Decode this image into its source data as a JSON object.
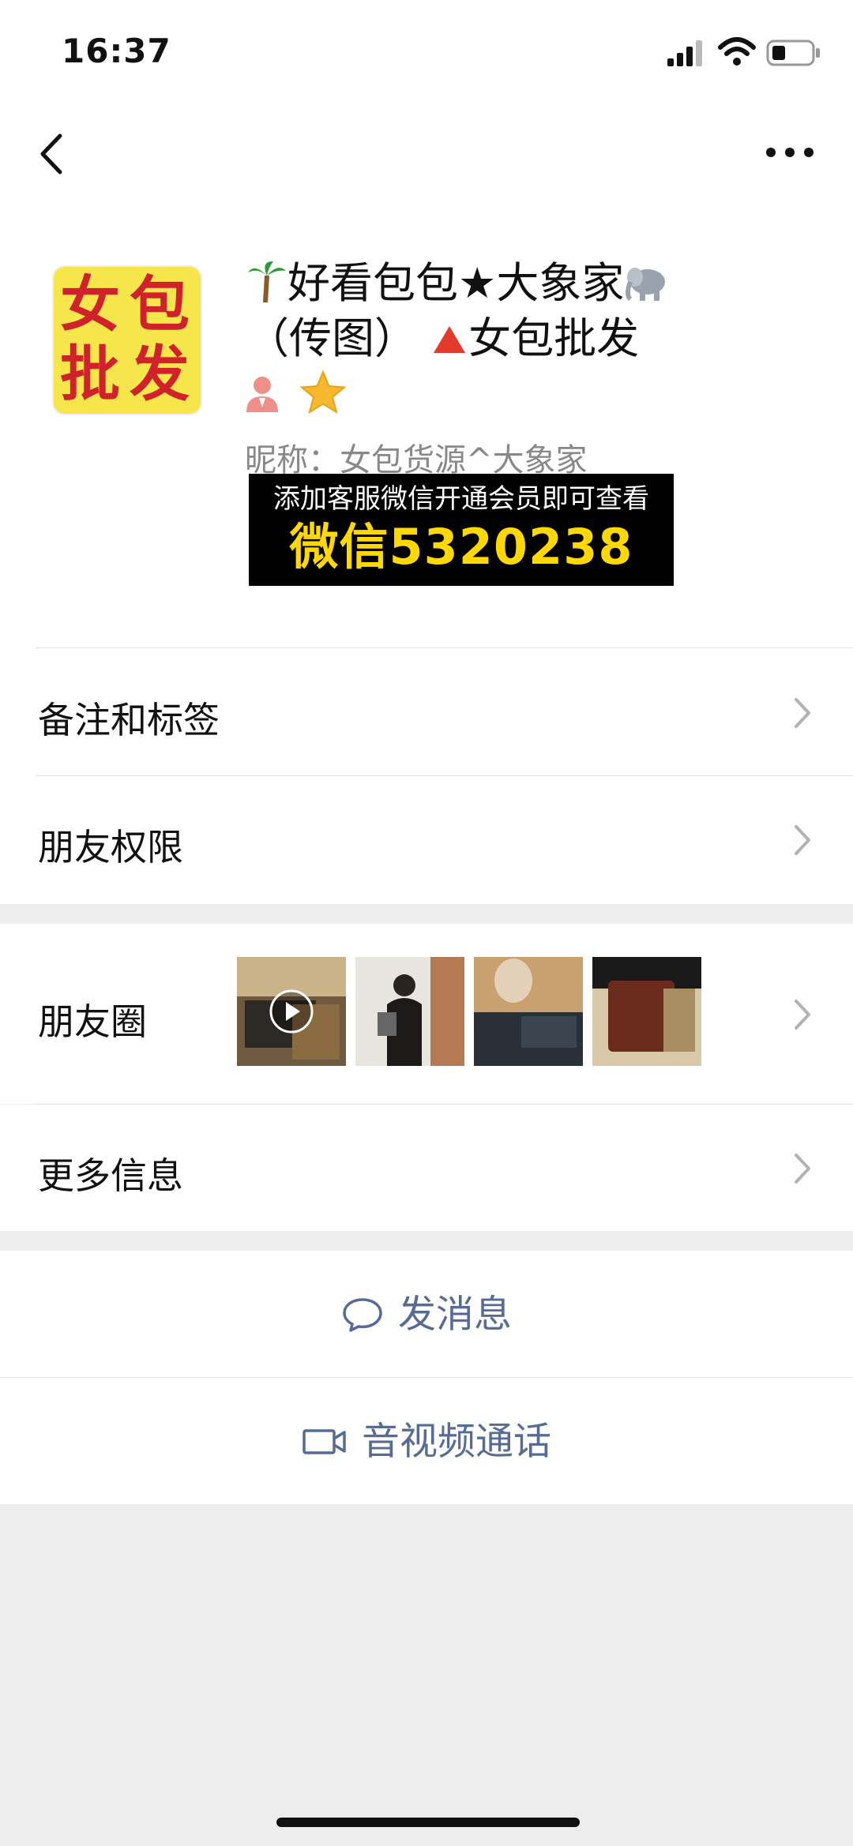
{
  "status": {
    "time": "16:37"
  },
  "profile": {
    "avatar_chars": [
      "女",
      "包",
      "批",
      "发"
    ],
    "title_line1": "好看包包★大象家",
    "title_line2": "（传图）",
    "title_line2b": "女包批发",
    "nickname": "昵称：女包货源^大象家"
  },
  "overlay": {
    "line1": "添加客服微信开通会员即可查看",
    "line2": "微信5320238"
  },
  "menu": {
    "remark": "备注和标签",
    "permissions": "朋友权限",
    "moments": "朋友圈",
    "more_info": "更多信息"
  },
  "actions": {
    "message": "发消息",
    "call": "音视频通话"
  },
  "colors": {
    "link_blue": "#576b95",
    "accent_yellow": "#ffd800",
    "avatar_bg": "#f7e64b",
    "avatar_text": "#d0222a"
  }
}
